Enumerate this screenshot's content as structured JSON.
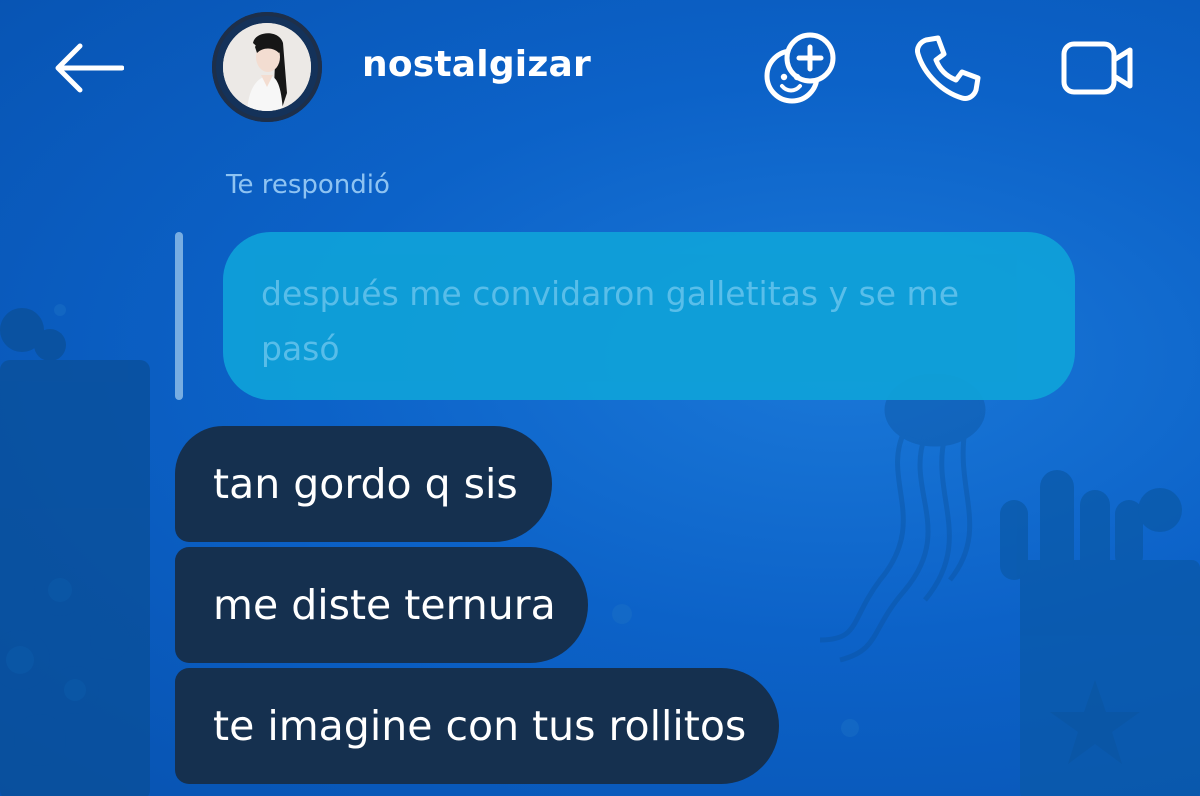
{
  "header": {
    "back_icon": "arrow-left-icon",
    "username": "nostalgizar",
    "games_icon": "games-plus-icon",
    "call_icon": "phone-icon",
    "video_icon": "video-camera-icon"
  },
  "reply": {
    "label": "Te respondió",
    "quoted_text": "después me convidaron galletitas y se me pasó"
  },
  "messages": [
    {
      "text": "tan gordo q sis"
    },
    {
      "text": "me diste ternura"
    },
    {
      "text": "te imagine con tus rollitos"
    }
  ],
  "colors": {
    "background": "#0c62c8",
    "incoming_bubble": "#15304f",
    "quoted_bubble": "#0fa2d9",
    "text": "#ffffff"
  }
}
